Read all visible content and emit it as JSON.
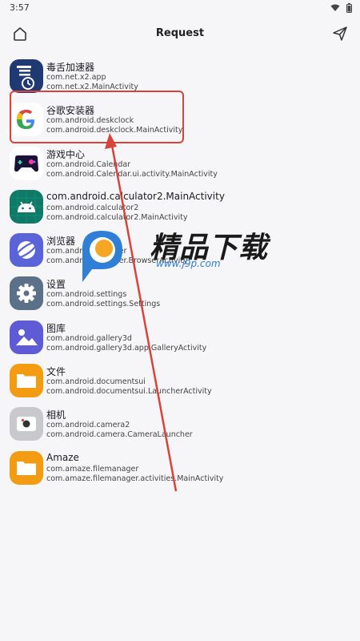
{
  "status_bar": {
    "time": "3:57"
  },
  "app_bar": {
    "title": "Request"
  },
  "apps": [
    {
      "name": "毒舌加速器",
      "package": "com.net.x2.app",
      "activity": "com.net.x2.MainActivity",
      "icon": "dushe-accelerator-icon"
    },
    {
      "name": "谷歌安装器",
      "package": "com.android.deskclock",
      "activity": "com.android.deskclock.MainActivity",
      "icon": "google-icon"
    },
    {
      "name": "游戏中心",
      "package": "com.android.Calendar",
      "activity": "com.android.Calendar.ui.activity.MainActivity",
      "icon": "gamepad-icon"
    },
    {
      "name": "com.android.calculator2.MainActivity",
      "package": "com.android.calculator2",
      "activity": "com.android.calculator2.MainActivity",
      "icon": "android-robot-icon"
    },
    {
      "name": "浏览器",
      "package": "com.android.browser",
      "activity": "com.android.browser.BrowserActivity",
      "icon": "planet-icon"
    },
    {
      "name": "设置",
      "package": "com.android.settings",
      "activity": "com.android.settings.Settings",
      "icon": "gear-icon"
    },
    {
      "name": "图库",
      "package": "com.android.gallery3d",
      "activity": "com.android.gallery3d.app.GalleryActivity",
      "icon": "gallery-icon"
    },
    {
      "name": "文件",
      "package": "com.android.documentsui",
      "activity": "com.android.documentsui.LauncherActivity",
      "icon": "folder-icon"
    },
    {
      "name": "相机",
      "package": "com.android.camera2",
      "activity": "com.android.camera.CameraLauncher",
      "icon": "camera-icon"
    },
    {
      "name": "Amaze",
      "package": "com.amaze.filemanager",
      "activity": "com.amaze.filemanager.activities.MainActivity",
      "icon": "folder-icon"
    }
  ],
  "watermark": {
    "text": "精品下载",
    "url": "www.j9p.com"
  },
  "colors": {
    "background": "#f6f5f8",
    "annotation": "#d8433a"
  }
}
